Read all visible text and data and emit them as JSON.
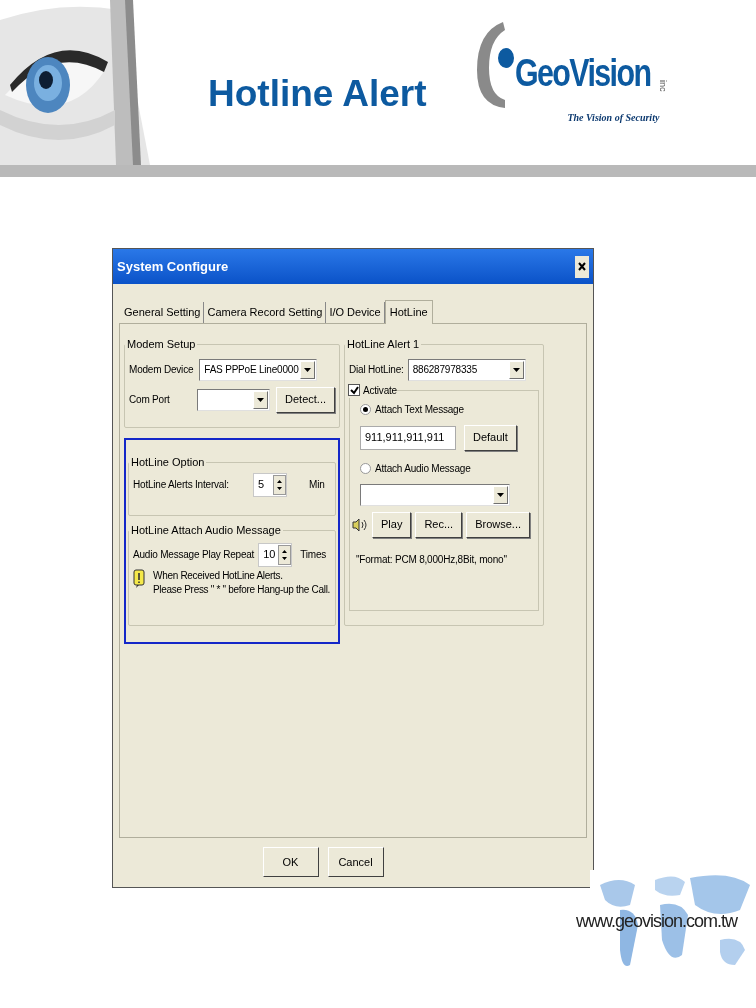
{
  "slide": {
    "title": "Hotline Alert",
    "logo": {
      "name": "GeoVision",
      "suffix": "inc",
      "tagline": "The Vision of Security"
    },
    "url": "www.geovision.com.tw"
  },
  "window": {
    "title": "System Configure"
  },
  "tabs": [
    {
      "label": "General Setting",
      "selected": false
    },
    {
      "label": "Camera Record Setting",
      "selected": false
    },
    {
      "label": "I/O Device",
      "selected": false
    },
    {
      "label": "HotLine",
      "selected": true
    }
  ],
  "modem_setup": {
    "title": "Modem Setup",
    "modem_device": {
      "label": "Modem Device",
      "value": "FAS PPPoE Line0000"
    },
    "com_port": {
      "label": "Com Port",
      "button": "Detect..."
    }
  },
  "hotline_option": {
    "title": "HotLine Option",
    "label": "HotLine Alerts Interval:",
    "value": "5",
    "unit": "Min"
  },
  "audio_option": {
    "title": "HotLine Attach Audio Message",
    "label": "Audio Message Play Repeat",
    "value": "10",
    "unit": "Times",
    "note": "When Received HotLine Alerts.\nPlease Press \" * \" before Hang-up the Call."
  },
  "hotline_alert": {
    "title": "HotLine Alert 1",
    "dial_label": "Dial HotLine:",
    "dial_value": "886287978335",
    "activate": {
      "label": "Activate",
      "checked": true
    },
    "options": [
      {
        "label": "Attach Text Message",
        "selected": true
      },
      {
        "label": "Attach Audio Message",
        "selected": false
      }
    ],
    "text_message": "911,911,911,911",
    "default_button": "Default",
    "audio_buttons": [
      "Play",
      "Rec...",
      "Browse..."
    ],
    "format": "\"Format: PCM 8,000Hz,8Bit, mono\""
  },
  "buttons": [
    "OK",
    "Cancel"
  ]
}
